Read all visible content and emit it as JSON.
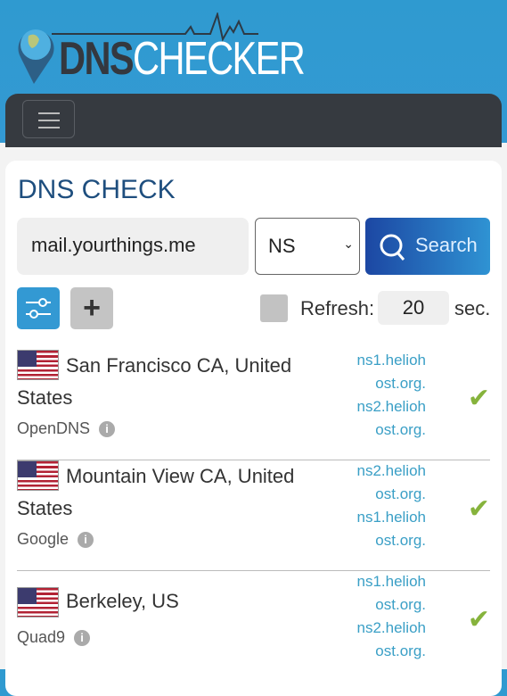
{
  "brand": {
    "logo_dark": "DNS",
    "logo_light": "CHECKER"
  },
  "nav": {
    "menu_icon": "hamburger-icon"
  },
  "page_title": "DNS CHECK",
  "search": {
    "domain_value": "mail.yourthings.me",
    "record_type": "NS",
    "button_label": "Search"
  },
  "refresh": {
    "label": "Refresh:",
    "value": "20",
    "unit": "sec.",
    "enabled": false
  },
  "colors": {
    "header": "#3399d3",
    "nav": "#363a40",
    "title": "#1e4e7e",
    "link": "#3a9fc6",
    "check": "#86b33c"
  },
  "results": [
    {
      "location": "San Francisco CA, United States",
      "provider": "OpenDNS",
      "records": [
        "ns1.helioh ost.org.",
        "ns2.helioh ost.org."
      ],
      "status": "ok"
    },
    {
      "location": "Mountain View CA, United States",
      "provider": "Google",
      "records": [
        "ns2.helioh ost.org.",
        "ns1.helioh ost.org."
      ],
      "status": "ok"
    },
    {
      "location": "Berkeley, US",
      "provider": "Quad9",
      "records": [
        "ns1.helioh ost.org.",
        "ns2.helioh ost.org."
      ],
      "status": "ok"
    }
  ]
}
